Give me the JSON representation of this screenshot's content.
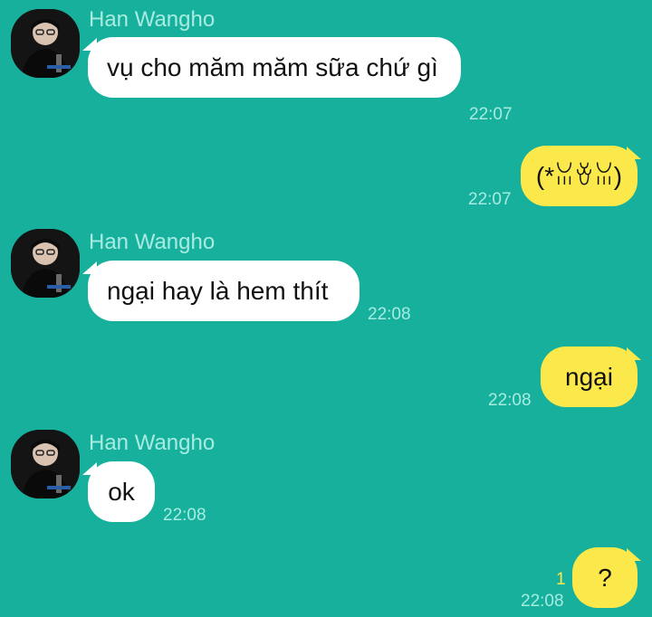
{
  "chat": {
    "messages": [
      {
        "sender": "Han Wangho",
        "text": "vụ cho măm măm sữa chứ gì",
        "time": "22:07",
        "direction": "incoming"
      },
      {
        "text": "(*ꈍꈊꈍ)",
        "time": "22:07",
        "direction": "outgoing"
      },
      {
        "sender": "Han Wangho",
        "text": "ngại hay là hem thít",
        "time": "22:08",
        "direction": "incoming"
      },
      {
        "text": "ngại",
        "time": "22:08",
        "direction": "outgoing"
      },
      {
        "sender": "Han Wangho",
        "text": "ok",
        "time": "22:08",
        "direction": "incoming"
      },
      {
        "text": "?",
        "time": "22:08",
        "direction": "outgoing",
        "unread_count": "1"
      }
    ]
  },
  "colors": {
    "background": "#16b09c",
    "incoming_bubble": "#ffffff",
    "outgoing_bubble": "#fbe84a",
    "meta_text": "#a8ece1",
    "unread": "#fbe84a"
  },
  "icons": {
    "avatar": "avatar-icon"
  }
}
